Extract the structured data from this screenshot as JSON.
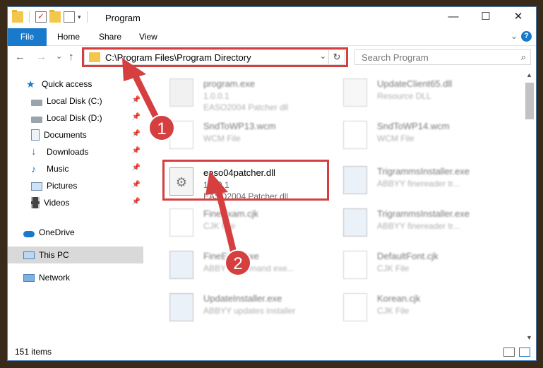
{
  "window": {
    "title": "Program",
    "controls": {
      "minimize": "—",
      "maximize": "☐",
      "close": "✕"
    }
  },
  "ribbon": {
    "tabs": [
      "File",
      "Home",
      "Share",
      "View"
    ],
    "help": "?"
  },
  "nav": {
    "back": "←",
    "forward": "→",
    "recent": "⌄",
    "up": "↑",
    "address": "C:\\Program Files\\Program Directory",
    "search_placeholder": "Search Program"
  },
  "sidebar": {
    "items": [
      {
        "label": "Quick access",
        "icon": "star-icon"
      },
      {
        "label": "Local Disk (C:)",
        "icon": "drive-icon",
        "pinned": true
      },
      {
        "label": "Local Disk (D:)",
        "icon": "drive-icon",
        "pinned": true
      },
      {
        "label": "Documents",
        "icon": "documents-icon",
        "pinned": true
      },
      {
        "label": "Downloads",
        "icon": "downloads-icon",
        "pinned": true
      },
      {
        "label": "Music",
        "icon": "music-icon",
        "pinned": true
      },
      {
        "label": "Pictures",
        "icon": "pictures-icon",
        "pinned": true
      },
      {
        "label": "Videos",
        "icon": "videos-icon",
        "pinned": true
      },
      {
        "label": "OneDrive",
        "icon": "cloud-icon"
      },
      {
        "label": "This PC",
        "icon": "pc-icon",
        "selected": true
      },
      {
        "label": "Network",
        "icon": "network-icon"
      }
    ]
  },
  "files": [
    {
      "name": "program.exe",
      "line1": "1.0.0.1",
      "line2": "EASO2004 Patcher dll",
      "icon": "exe-icon"
    },
    {
      "name": "UpdateClient65.dll",
      "line1": "Resource DLL",
      "line2": "",
      "icon": "dll-icon"
    },
    {
      "name": "SndToWP13.wcm",
      "line1": "WCM File",
      "line2": "",
      "icon": "blank-file-icon"
    },
    {
      "name": "SndToWP14.wcm",
      "line1": "WCM File",
      "line2": "",
      "icon": "blank-file-icon"
    },
    {
      "name": "easo04patcher.dll",
      "line1": "1.0.0.1",
      "line2": "EASO2004 Patcher dll",
      "icon": "dll-icon"
    },
    {
      "name": "TrigrammsInstaller.exe",
      "line1": "ABBYY finereader tr...",
      "line2": "",
      "icon": "installer-icon"
    },
    {
      "name": "FineExam.cjk",
      "line1": "CJK File",
      "line2": "",
      "icon": "blank-file-icon"
    },
    {
      "name": "TrigrammsInstaller.exe",
      "line1": "ABBYY finereader tr...",
      "line2": "",
      "icon": "installer-icon"
    },
    {
      "name": "FineExec.exe",
      "line1": "ABBYY command exe...",
      "line2": "",
      "icon": "installer-icon"
    },
    {
      "name": "DefaultFont.cjk",
      "line1": "CJK File",
      "line2": "",
      "icon": "blank-file-icon"
    },
    {
      "name": "UpdateInstaller.exe",
      "line1": "ABBYY updates installer",
      "line2": "",
      "icon": "installer-icon"
    },
    {
      "name": "Korean.cjk",
      "line1": "CJK File",
      "line2": "",
      "icon": "blank-file-icon"
    }
  ],
  "annotations": {
    "step1": "1",
    "step2": "2"
  },
  "status": {
    "item_count": "151 items"
  },
  "colors": {
    "accent": "#1979ca",
    "annotation_red": "#d53f3f"
  }
}
